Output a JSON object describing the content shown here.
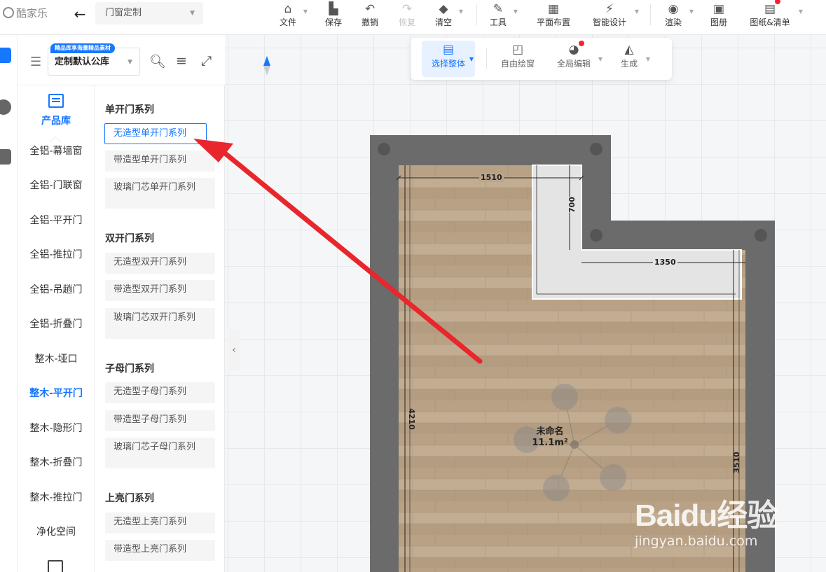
{
  "app": {
    "logo_text": "酷家乐",
    "mode_select": "门窗定制"
  },
  "toolbar": {
    "items": [
      {
        "label": "文件",
        "icon": "home-icon"
      },
      {
        "label": "保存",
        "icon": "save-icon"
      },
      {
        "label": "撤销",
        "icon": "undo-icon"
      },
      {
        "label": "恢复",
        "icon": "redo-icon",
        "disabled": true
      },
      {
        "label": "清空",
        "icon": "eraser-icon"
      },
      {
        "label": "工具",
        "icon": "wrench-icon"
      },
      {
        "label": "平面布置",
        "icon": "layout-icon"
      },
      {
        "label": "智能设计",
        "icon": "lightning-icon"
      },
      {
        "label": "渲染",
        "icon": "camera-icon"
      },
      {
        "label": "图册",
        "icon": "image-icon"
      },
      {
        "label": "图纸&清单",
        "icon": "drawing-icon"
      }
    ]
  },
  "panel": {
    "library_badge": "精品库享海量精品素材",
    "library_select": "定制默认公库",
    "category_tab": "产品库",
    "categories": [
      {
        "label": "全铝-幕墙窗"
      },
      {
        "label": "全铝-门联窗"
      },
      {
        "label": "全铝-平开门"
      },
      {
        "label": "全铝-推拉门"
      },
      {
        "label": "全铝-吊趟门"
      },
      {
        "label": "全铝-折叠门"
      },
      {
        "label": "整木-垭口"
      },
      {
        "label": "整木-平开门",
        "active": true
      },
      {
        "label": "整木-隐形门"
      },
      {
        "label": "整木-折叠门"
      },
      {
        "label": "整木-推拉门"
      },
      {
        "label": "净化空间"
      }
    ],
    "groups": [
      {
        "title": "单开门系列",
        "items": [
          "无造型单开门系列",
          "带造型单开门系列",
          "玻璃门芯单开门系列"
        ]
      },
      {
        "title": "双开门系列",
        "items": [
          "无造型双开门系列",
          "带造型双开门系列",
          "玻璃门芯双开门系列"
        ]
      },
      {
        "title": "子母门系列",
        "items": [
          "无造型子母门系列",
          "带造型子母门系列",
          "玻璃门芯子母门系列"
        ]
      },
      {
        "title": "上亮门系列",
        "items": [
          "无造型上亮门系列",
          "带造型上亮门系列"
        ]
      }
    ],
    "selected_item": "无造型单开门系列"
  },
  "canvas_toolbar": {
    "items": [
      {
        "label": "选择整体",
        "icon": "select-icon",
        "active": true
      },
      {
        "label": "自由绘窗",
        "icon": "draw-window-icon"
      },
      {
        "label": "全局编辑",
        "icon": "global-edit-icon"
      },
      {
        "label": "生成",
        "icon": "generate-icon"
      }
    ]
  },
  "plan": {
    "dimensions": [
      "1510",
      "700",
      "1350",
      "4210",
      "3510"
    ],
    "room_name": "未命名",
    "room_area": "11.1m²"
  },
  "watermark": {
    "brand": "Baidu经验",
    "url": "jingyan.baidu.com"
  },
  "colors": {
    "accent": "#1677ff",
    "arrow": "#e8262c",
    "wall": "#6b6b6b",
    "floor": "#b9a38a"
  }
}
